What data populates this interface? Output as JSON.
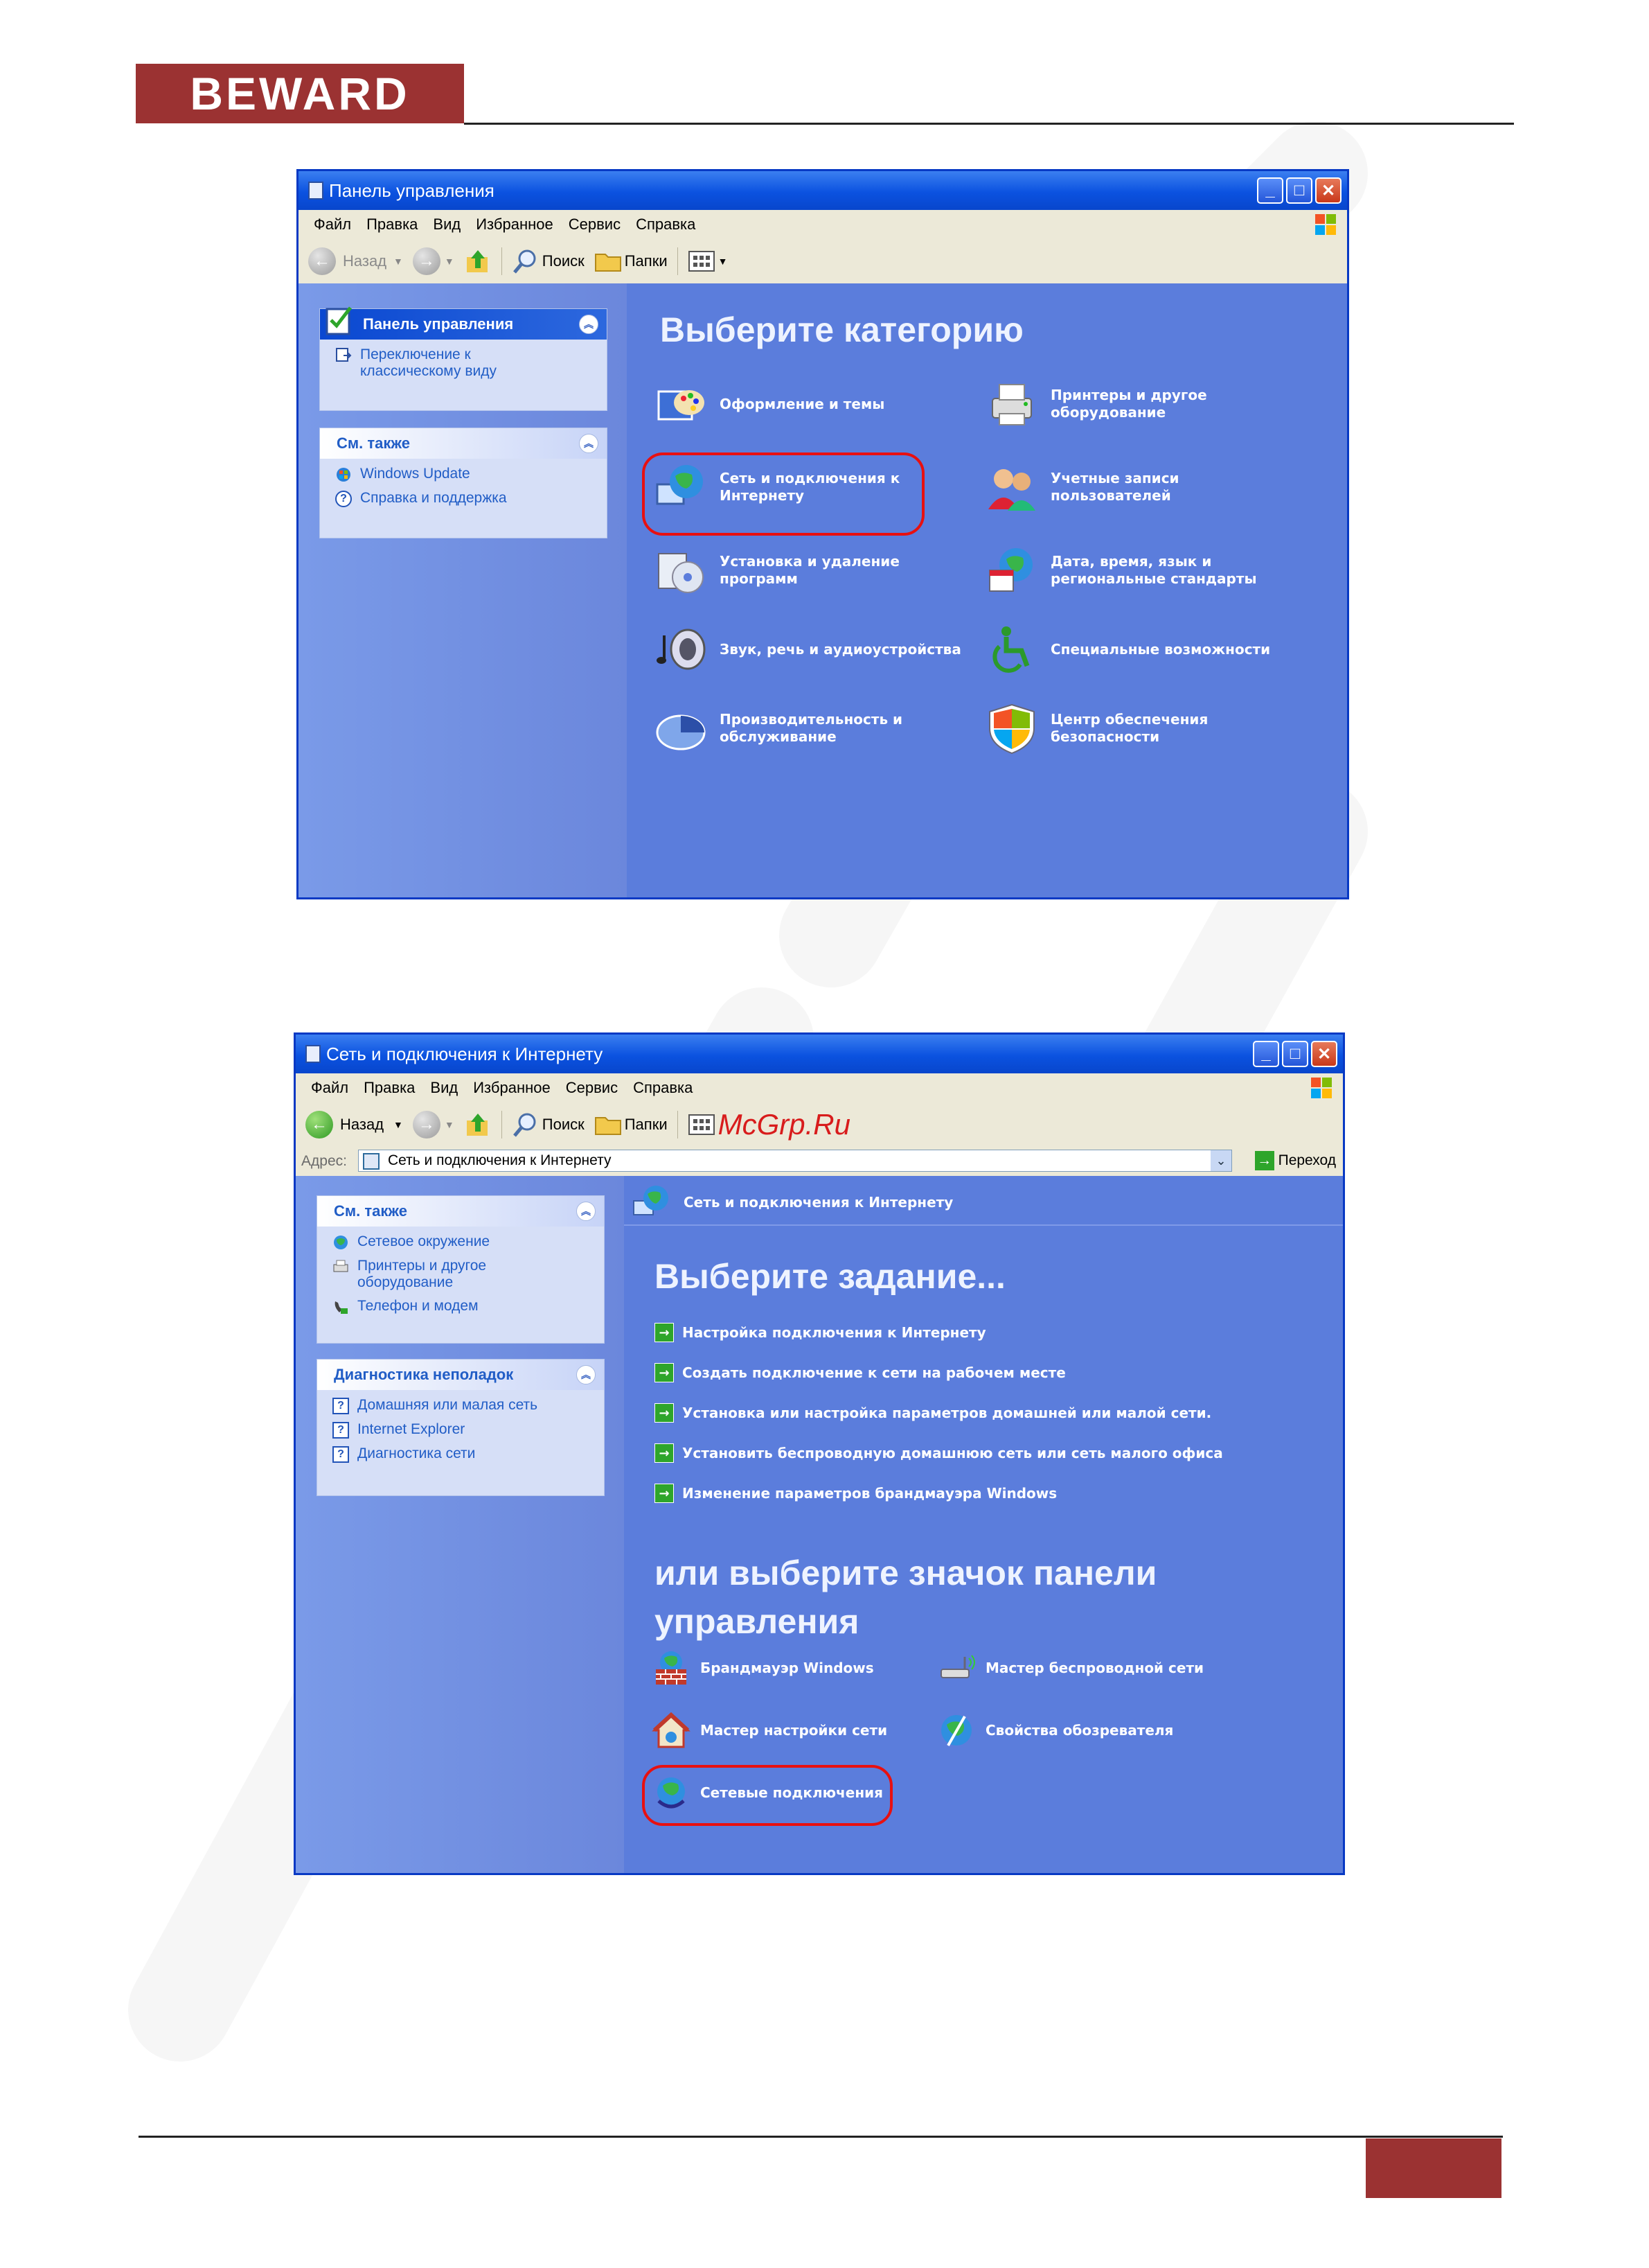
{
  "header": {
    "logo_text": "BEWARD"
  },
  "brand_color": "#9b3232",
  "footer": {
    "page_number": ""
  },
  "window1": {
    "title": "Панель управления",
    "menu": [
      "Файл",
      "Правка",
      "Вид",
      "Избранное",
      "Сервис",
      "Справка"
    ],
    "toolbar": {
      "back": "Назад",
      "search": "Поиск",
      "folders": "Папки"
    },
    "panel": {
      "title": "Панель управления",
      "switch_link": "Переключение к классическому виду"
    },
    "see_also": {
      "title": "См. также",
      "links": [
        "Windows Update",
        "Справка и поддержка"
      ]
    },
    "heading": "Выберите категорию",
    "categories": [
      {
        "label": "Оформление и темы",
        "icon": "appearance-icon"
      },
      {
        "label": "Принтеры и другое оборудование",
        "icon": "printer-icon"
      },
      {
        "label": "Сеть и подключения к Интернету",
        "icon": "network-icon"
      },
      {
        "label": "Учетные записи пользователей",
        "icon": "users-icon"
      },
      {
        "label": "Установка и удаление программ",
        "icon": "install-icon"
      },
      {
        "label": "Дата, время, язык и региональные стандарты",
        "icon": "datetime-icon"
      },
      {
        "label": "Звук, речь и аудиоустройства",
        "icon": "sound-icon"
      },
      {
        "label": "Специальные возможности",
        "icon": "accessibility-icon"
      },
      {
        "label": "Производительность и обслуживание",
        "icon": "performance-icon"
      },
      {
        "label": "Центр обеспечения безопасности",
        "icon": "shield-icon"
      }
    ]
  },
  "window2": {
    "title": "Сеть и подключения к Интернету",
    "menu": [
      "Файл",
      "Правка",
      "Вид",
      "Избранное",
      "Сервис",
      "Справка"
    ],
    "toolbar": {
      "back": "Назад",
      "search": "Поиск",
      "folders": "Папки"
    },
    "watermark_text": "McGrp.Ru",
    "address": {
      "label": "Адрес:",
      "value": "Сеть и подключения к Интернету",
      "go": "Переход"
    },
    "see_also": {
      "title": "См. также",
      "links": [
        "Сетевое окружение",
        "Принтеры и другое оборудование",
        "Телефон и модем"
      ]
    },
    "troubleshoot": {
      "title": "Диагностика неполадок",
      "links": [
        "Домашняя или малая сеть",
        "Internet Explorer",
        "Диагностика сети"
      ]
    },
    "breadcrumb": "Сеть и подключения к Интернету",
    "heading": "Выберите задание...",
    "tasks": [
      "Настройка подключения к Интернету",
      "Создать подключение к сети на рабочем месте",
      "Установка или настройка параметров домашней или малой сети.",
      "Установить беспроводную домашнюю сеть или сеть малого офиса",
      "Изменение параметров брандмауэра Windows"
    ],
    "subheading_line1": "или выберите значок панели",
    "subheading_line2": "управления",
    "icons": [
      {
        "label": "Брандмауэр Windows",
        "icon": "firewall-icon"
      },
      {
        "label": "Мастер беспроводной сети",
        "icon": "wireless-icon"
      },
      {
        "label": "Мастер настройки сети",
        "icon": "home-network-icon"
      },
      {
        "label": "Свойства обозревателя",
        "icon": "internet-options-icon"
      },
      {
        "label": "Сетевые подключения",
        "icon": "network-connections-icon"
      }
    ]
  }
}
